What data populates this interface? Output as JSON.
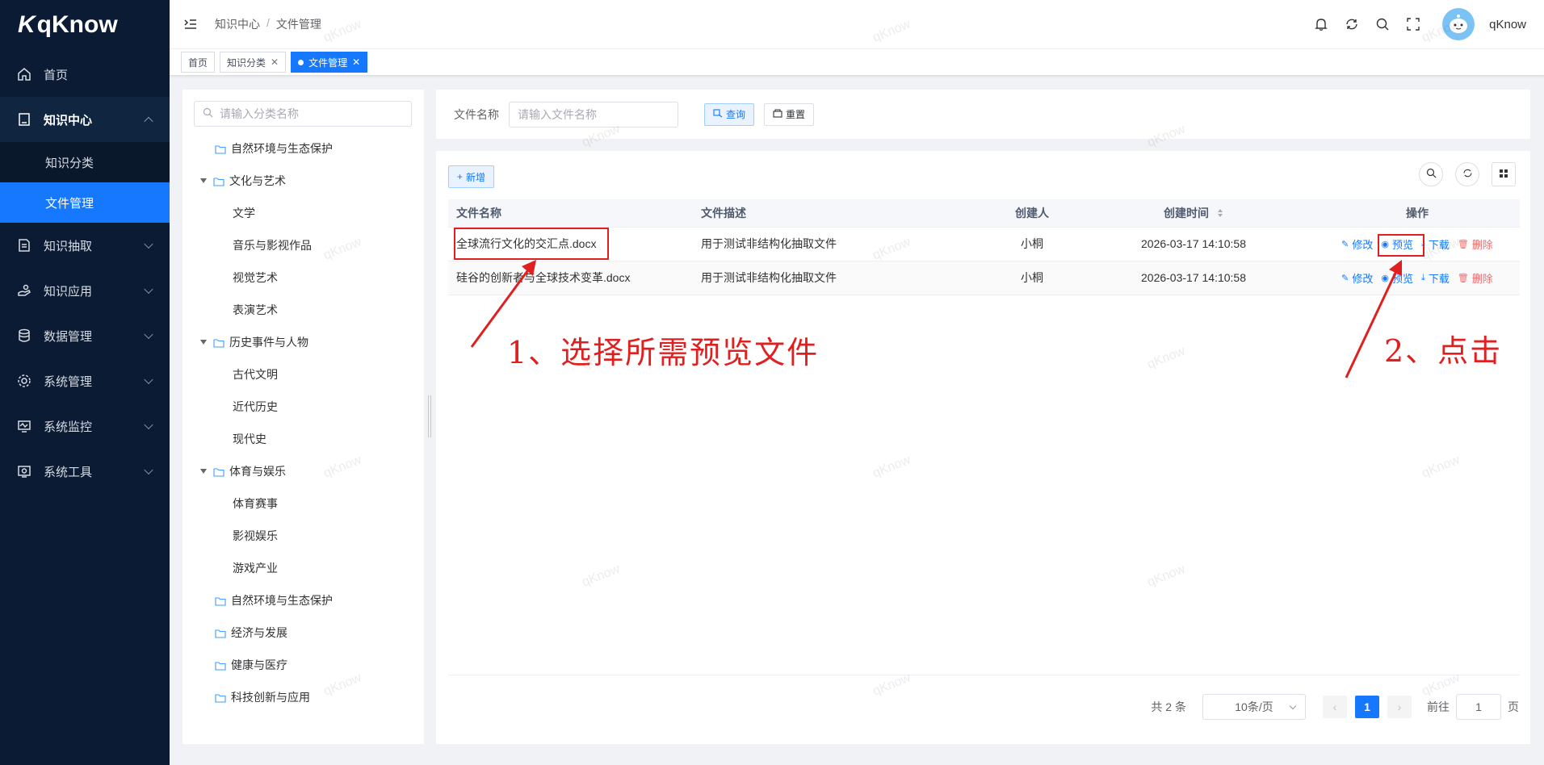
{
  "app": {
    "logo_text": "qKnow"
  },
  "sidebar": {
    "items": [
      {
        "label": "首页",
        "icon": "home-icon"
      },
      {
        "label": "知识中心",
        "icon": "book-icon",
        "open": true,
        "children": [
          {
            "label": "知识分类"
          },
          {
            "label": "文件管理",
            "active": true
          }
        ]
      },
      {
        "label": "知识抽取",
        "icon": "extract-icon"
      },
      {
        "label": "知识应用",
        "icon": "hand-icon"
      },
      {
        "label": "数据管理",
        "icon": "database-icon"
      },
      {
        "label": "系统管理",
        "icon": "gear-icon"
      },
      {
        "label": "系统监控",
        "icon": "monitor-icon"
      },
      {
        "label": "系统工具",
        "icon": "tools-icon"
      }
    ]
  },
  "header": {
    "breadcrumb": [
      "知识中心",
      "文件管理"
    ],
    "user_name": "qKnow"
  },
  "tags": [
    {
      "label": "首页"
    },
    {
      "label": "知识分类",
      "closable": true
    },
    {
      "label": "文件管理",
      "closable": true,
      "active": true
    }
  ],
  "tree": {
    "search_placeholder": "请输入分类名称",
    "nodes": [
      {
        "label": "自然环境与生态保护",
        "level": 1,
        "folder": true
      },
      {
        "label": "文化与艺术",
        "level": 1,
        "folder": true,
        "expanded": true
      },
      {
        "label": "文学",
        "level": 2
      },
      {
        "label": "音乐与影视作品",
        "level": 2
      },
      {
        "label": "视觉艺术",
        "level": 2
      },
      {
        "label": "表演艺术",
        "level": 2
      },
      {
        "label": "历史事件与人物",
        "level": 1,
        "folder": true,
        "expanded": true
      },
      {
        "label": "古代文明",
        "level": 2
      },
      {
        "label": "近代历史",
        "level": 2
      },
      {
        "label": "现代史",
        "level": 2
      },
      {
        "label": "体育与娱乐",
        "level": 1,
        "folder": true,
        "expanded": true
      },
      {
        "label": "体育赛事",
        "level": 2
      },
      {
        "label": "影视娱乐",
        "level": 2
      },
      {
        "label": "游戏产业",
        "level": 2
      },
      {
        "label": "自然环境与生态保护",
        "level": 1,
        "folder": true
      },
      {
        "label": "经济与发展",
        "level": 1,
        "folder": true
      },
      {
        "label": "健康与医疗",
        "level": 1,
        "folder": true
      },
      {
        "label": "科技创新与应用",
        "level": 1,
        "folder": true
      }
    ]
  },
  "search_form": {
    "label": "文件名称",
    "placeholder": "请输入文件名称",
    "query_label": "查询",
    "reset_label": "重置"
  },
  "toolbar": {
    "add_label": "新增"
  },
  "table": {
    "columns": [
      "文件名称",
      "文件描述",
      "创建人",
      "创建时间",
      "操作"
    ],
    "rows": [
      {
        "name": "全球流行文化的交汇点.docx",
        "desc": "用于测试非结构化抽取文件",
        "creator": "小桐",
        "time": "2026-03-17 14:10:58"
      },
      {
        "name": "硅谷的创新者与全球技术变革.docx",
        "desc": "用于测试非结构化抽取文件",
        "creator": "小桐",
        "time": "2026-03-17 14:10:58"
      }
    ],
    "ops": {
      "edit": "修改",
      "preview": "预览",
      "download": "下载",
      "delete": "删除"
    }
  },
  "pagination": {
    "total_text": "共 2 条",
    "page_size": "10条/页",
    "current_page": "1",
    "goto_label": "前往",
    "goto_value": "1",
    "page_suffix": "页"
  },
  "annotations": {
    "step1": "1、选择所需预览文件",
    "step2": "2、点击"
  },
  "watermark": "qKnow",
  "colors": {
    "primary": "#1677ff",
    "sidebar_bg": "#0b1b33",
    "annotation": "#e02020",
    "danger": "#f56c6c"
  }
}
